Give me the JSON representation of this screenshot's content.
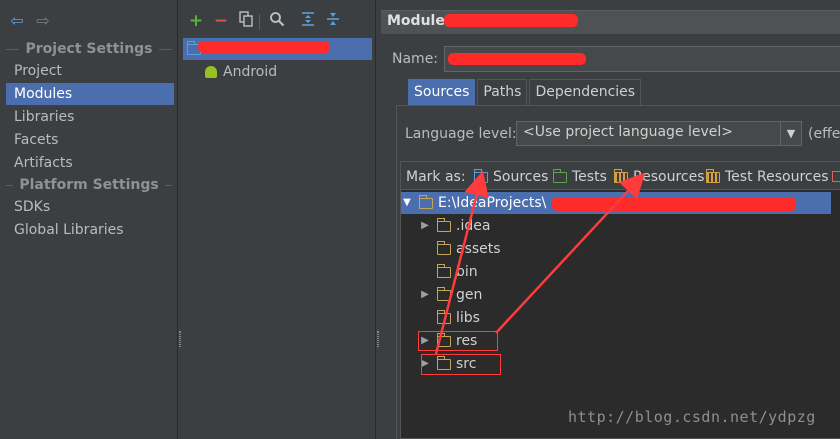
{
  "nav": {
    "back_icon": "back-arrow-icon",
    "forward_icon": "forward-arrow-icon"
  },
  "left_panel": {
    "project_settings_header": "Project Settings",
    "project_items": [
      "Project",
      "Modules",
      "Libraries",
      "Facets",
      "Artifacts"
    ],
    "platform_settings_header": "Platform Settings",
    "platform_items": [
      "SDKs",
      "Global Libraries"
    ],
    "selected": "Modules"
  },
  "module_toolbar": {
    "icons": [
      "add-icon",
      "remove-icon",
      "copy-icon",
      "find-icon",
      "expand-all-icon",
      "collapse-all-icon"
    ],
    "add_glyph": "+",
    "remove_glyph": "−"
  },
  "module_tree": {
    "child": "Android"
  },
  "module_editor": {
    "header_prefix": "Module",
    "name_label": "Name:",
    "tabs": [
      "Sources",
      "Paths",
      "Dependencies"
    ],
    "active_tab": "Sources",
    "language_level_label": "Language level:",
    "language_level_value": "<Use project language level>",
    "language_level_suffix": "(effe",
    "mark_as_label": "Mark as:",
    "mark_as_options": [
      "Sources",
      "Tests",
      "Resources",
      "Test Resources"
    ]
  },
  "content_tree": {
    "root_prefix": "E:\\IdeaProjects\\",
    "children": [
      ".idea",
      "assets",
      "bin",
      "gen",
      "libs",
      "res",
      "src"
    ]
  },
  "watermark": "http://blog.csdn.net/ydpzg",
  "colors": {
    "selection": "#4b6eaf",
    "background": "#3c3f41",
    "annotation": "#ff3b3b"
  }
}
